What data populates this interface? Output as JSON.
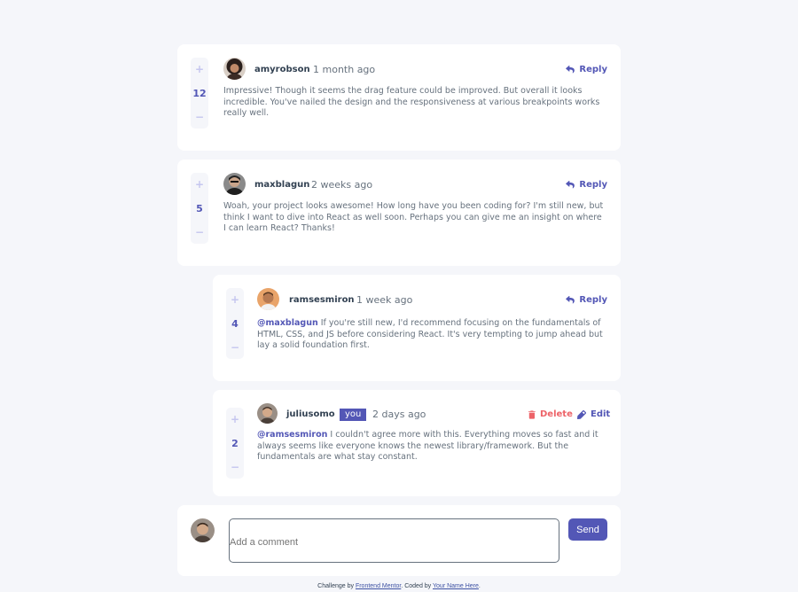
{
  "colors": {
    "accent": "#5357b6",
    "accent_light": "#c5c6ef",
    "danger": "#ed6368",
    "background": "#f5f6fa",
    "card": "#ffffff",
    "heading": "#324152",
    "text": "#67727e"
  },
  "comments": [
    {
      "score": "12",
      "username": "amyrobson",
      "date": "1 month ago",
      "reply_label": "Reply",
      "text": "Impressive! Though it seems the drag feature could be improved. But overall it looks incredible. You've nailed the design and the responsiveness at various breakpoints works really well."
    },
    {
      "score": "5",
      "username": "maxblagun",
      "date": "2 weeks ago",
      "reply_label": "Reply",
      "text": "Woah, your project looks awesome! How long have you been coding for? I'm still new, but think I want to dive into React as well soon. Perhaps you can give me an insight on where I can learn React? Thanks!"
    }
  ],
  "replies": [
    {
      "score": "4",
      "username": "ramsesmiron",
      "date": "1 week ago",
      "reply_label": "Reply",
      "mention": "@maxblagun",
      "text": " If you're still new, I'd recommend focusing on the fundamentals of HTML, CSS, and JS before considering React. It's very tempting to jump ahead but lay a solid foundation first."
    },
    {
      "score": "2",
      "username": "juliusomo",
      "you_badge": "you",
      "date": "2 days ago",
      "delete_label": "Delete",
      "edit_label": "Edit",
      "mention": "@ramsesmiron",
      "text": " I couldn't agree more with this. Everything moves so fast and it always seems like everyone knows the newest library/framework. But the fundamentals are what stay constant."
    }
  ],
  "vote": {
    "plus": "+",
    "minus": "−"
  },
  "add_comment": {
    "placeholder": "Add a comment",
    "send_label": "Send"
  },
  "attribution": {
    "prefix": "Challenge by ",
    "link1": "Frontend Mentor",
    "middle": ". Coded by ",
    "link2": "Your Name Here",
    "suffix": "."
  }
}
